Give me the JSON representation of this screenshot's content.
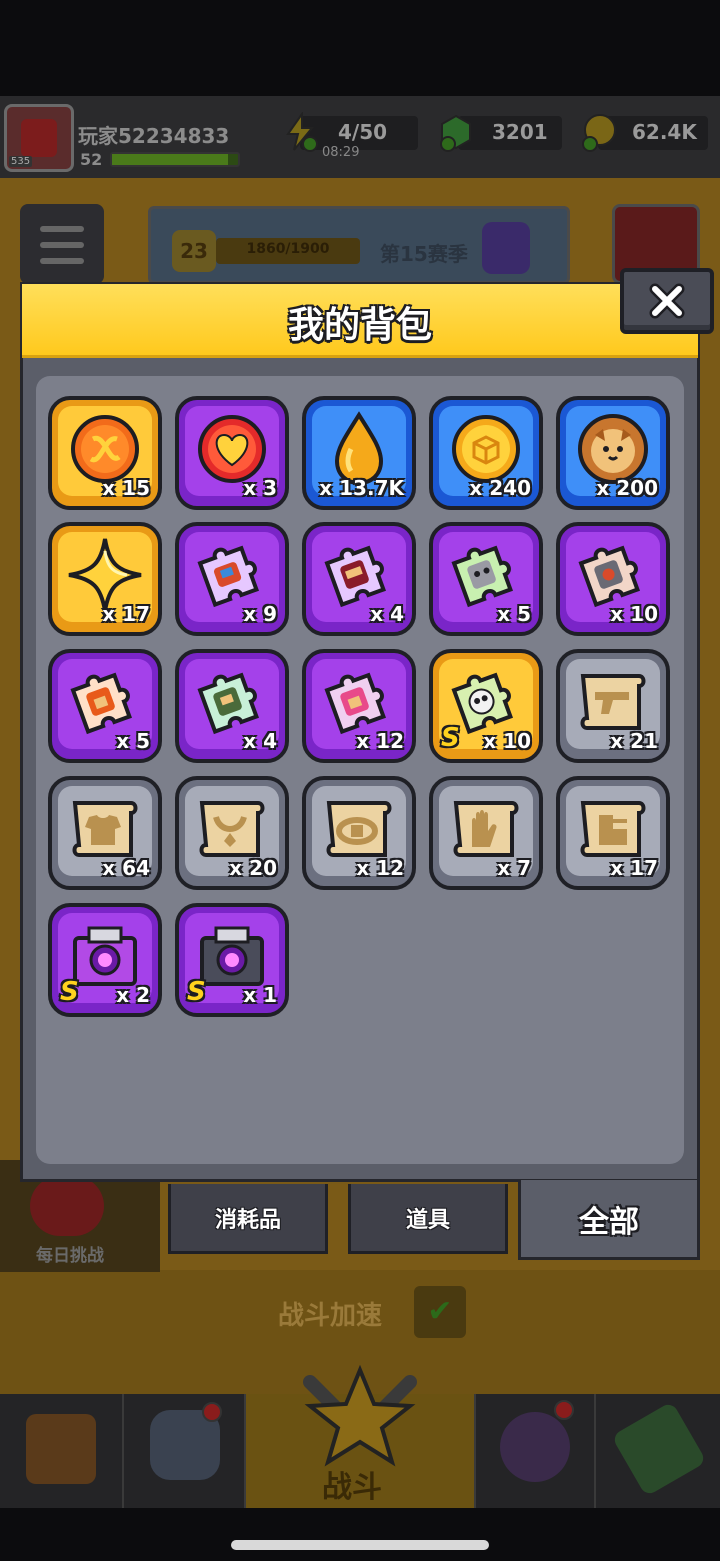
{
  "player": {
    "name": "玩家52234833",
    "level": "52",
    "avatar_chip": "535"
  },
  "resources": {
    "energy": "4/50",
    "energy_timer": "08:29",
    "gems": "3201",
    "coins": "62.4K"
  },
  "season": {
    "level": "23",
    "progress": "1860/1900",
    "progress_fraction": 0.98,
    "title": "第15赛季"
  },
  "daily_challenge": {
    "label": "每日挑战"
  },
  "battle_speed": {
    "label": "战斗加速",
    "checked": true
  },
  "bottom_nav": {
    "battle_label": "战斗"
  },
  "backpack": {
    "title": "我的背包",
    "items": [
      {
        "icon": "orange-token-icon",
        "rarity": "gold",
        "qty": "x 15"
      },
      {
        "icon": "heart-icon",
        "rarity": "purple",
        "qty": "x 3"
      },
      {
        "icon": "golden-drop-icon",
        "rarity": "blue",
        "qty": "x 13.7K"
      },
      {
        "icon": "gold-coin-icon",
        "rarity": "blue",
        "qty": "x 240"
      },
      {
        "icon": "dog-cookie-icon",
        "rarity": "blue",
        "qty": "x 200"
      },
      {
        "icon": "gold-star-icon",
        "rarity": "gold",
        "qty": "x 17"
      },
      {
        "icon": "puzzle-piece-icon",
        "rarity": "purple",
        "qty": "x 9"
      },
      {
        "icon": "puzzle-piece-icon",
        "rarity": "purple",
        "qty": "x 4"
      },
      {
        "icon": "puzzle-piece-icon",
        "rarity": "purple",
        "qty": "x 5"
      },
      {
        "icon": "puzzle-piece-icon",
        "rarity": "purple",
        "qty": "x 10"
      },
      {
        "icon": "puzzle-piece-icon",
        "rarity": "purple",
        "qty": "x 5"
      },
      {
        "icon": "puzzle-piece-icon",
        "rarity": "purple",
        "qty": "x 4"
      },
      {
        "icon": "puzzle-piece-icon",
        "rarity": "purple",
        "qty": "x 12"
      },
      {
        "icon": "puzzle-piece-icon",
        "rarity": "gold",
        "qty": "x 10",
        "badge": "S"
      },
      {
        "icon": "gun-scroll-icon",
        "rarity": "grey",
        "qty": "x 21"
      },
      {
        "icon": "armor-scroll-icon",
        "rarity": "grey",
        "qty": "x 64"
      },
      {
        "icon": "necklace-scroll-icon",
        "rarity": "grey",
        "qty": "x 20"
      },
      {
        "icon": "belt-scroll-icon",
        "rarity": "grey",
        "qty": "x 12"
      },
      {
        "icon": "glove-scroll-icon",
        "rarity": "grey",
        "qty": "x 7"
      },
      {
        "icon": "boots-scroll-icon",
        "rarity": "grey",
        "qty": "x 17"
      },
      {
        "icon": "purple-chest-icon",
        "rarity": "purple",
        "qty": "x 2",
        "badge": "S"
      },
      {
        "icon": "dark-chest-icon",
        "rarity": "purple",
        "qty": "x 1",
        "badge": "S"
      }
    ],
    "tabs": {
      "consumables": "消耗品",
      "props": "道具",
      "all": "全部"
    },
    "active_tab": "全部"
  },
  "colors": {
    "header_yellow": "#ffd23c",
    "panel_grey": "#5b5e69",
    "tile_purple": "#a441ea",
    "tile_gold": "#ffca3a",
    "tile_blue": "#3f8ff8",
    "tile_grey": "#a7abb8"
  }
}
